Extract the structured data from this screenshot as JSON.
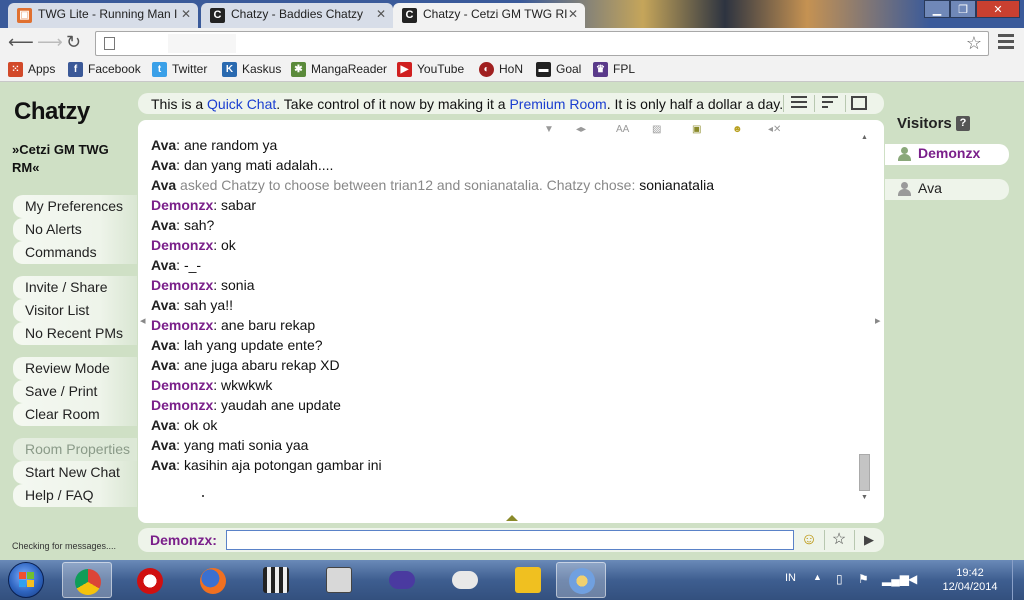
{
  "browser": {
    "tabs": [
      {
        "title": "TWG Lite - Running Man I"
      },
      {
        "title": "Chatzy - Baddies Chatzy"
      },
      {
        "title": "Chatzy - Cetzi GM TWG RI"
      }
    ],
    "bookmarks": [
      {
        "label": "Apps",
        "icon": "apps-grid-icon",
        "color": "#d24a2a"
      },
      {
        "label": "Facebook",
        "icon": "facebook-icon",
        "color": "#3b5998"
      },
      {
        "label": "Twitter",
        "icon": "twitter-icon",
        "color": "#3aa0e8"
      },
      {
        "label": "Kaskus",
        "icon": "kaskus-icon",
        "color": "#2a6ab0"
      },
      {
        "label": "MangaReader",
        "icon": "mangareader-icon",
        "color": "#5a8a3a"
      },
      {
        "label": "YouTube",
        "icon": "youtube-icon",
        "color": "#d02020"
      },
      {
        "label": "HoN",
        "icon": "hon-icon",
        "color": "#a02020"
      },
      {
        "label": "Goal",
        "icon": "goal-icon",
        "color": "#222222"
      },
      {
        "label": "FPL",
        "icon": "fpl-icon",
        "color": "#5a3a8a"
      }
    ]
  },
  "chatzy": {
    "logo": "Chatzy",
    "room_name": "»Cetzi GM TWG RM«",
    "menu_groups": [
      [
        {
          "label": "My Preferences"
        },
        {
          "label": "No Alerts"
        },
        {
          "label": "Commands"
        }
      ],
      [
        {
          "label": "Invite / Share"
        },
        {
          "label": "Visitor List"
        },
        {
          "label": "No Recent PMs"
        }
      ],
      [
        {
          "label": "Review Mode"
        },
        {
          "label": "Save / Print"
        },
        {
          "label": "Clear Room"
        }
      ],
      [
        {
          "label": "Room Properties"
        },
        {
          "label": "Start New Chat"
        },
        {
          "label": "Help / FAQ"
        }
      ]
    ],
    "status_text": "Checking for messages....",
    "notice": {
      "pre": "This is a ",
      "link1": "Quick Chat",
      "mid": ". Take control of it now by making it a ",
      "link2": "Premium Room",
      "post": ". It is only half a dollar a day."
    },
    "messages": [
      {
        "user": "Ava",
        "text": ": ane random ya"
      },
      {
        "user": "Ava",
        "text": ": dan yang mati adalah...."
      },
      {
        "user": "Ava",
        "system": true,
        "text": " asked Chatzy to choose between trian12 and sonianatalia. Chatzy chose: ",
        "highlight": "sonianatalia"
      },
      {
        "user": "Demonzx",
        "text": ": sabar"
      },
      {
        "user": "Ava",
        "text": ": sah?"
      },
      {
        "user": "Demonzx",
        "text": ": ok"
      },
      {
        "user": "Ava",
        "text": ": -_-"
      },
      {
        "user": "Demonzx",
        "text": ": sonia"
      },
      {
        "user": "Ava",
        "text": ": sah ya!!"
      },
      {
        "user": "Demonzx",
        "text": ": ane baru rekap"
      },
      {
        "user": "Ava",
        "text": ": lah yang update ente?"
      },
      {
        "user": "Ava",
        "text": ": ane juga abaru rekap XD"
      },
      {
        "user": "Demonzx",
        "text": ": wkwkwk"
      },
      {
        "user": "Demonzx",
        "text": ": yaudah ane update"
      },
      {
        "user": "Ava",
        "text": ": ok ok"
      },
      {
        "user": "Ava",
        "text": ": yang mati sonia yaa"
      },
      {
        "user": "Ava",
        "text": ": kasihin aja potongan gambar ini"
      }
    ],
    "input": {
      "label": "Demonzx:",
      "value": "",
      "placeholder": ""
    },
    "visitors": {
      "title": "Visitors",
      "help_label": "?",
      "list": [
        {
          "name": "Demonzx"
        },
        {
          "name": "Ava"
        }
      ]
    }
  },
  "taskbar": {
    "language": "IN",
    "clock_time": "19:42",
    "clock_date": "12/04/2014"
  }
}
